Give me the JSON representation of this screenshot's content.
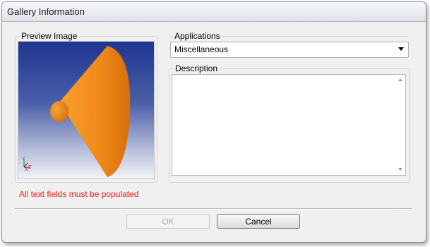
{
  "window": {
    "title": "Gallery Information"
  },
  "preview": {
    "label": "Preview Image",
    "axis_labels": [
      "Y",
      "X",
      "Z"
    ]
  },
  "applications": {
    "label": "Applications",
    "selected": "Miscellaneous"
  },
  "description": {
    "label": "Description",
    "value": ""
  },
  "validation": {
    "message": "All text fields must be populated"
  },
  "buttons": {
    "ok": "OK",
    "cancel": "Cancel"
  },
  "colors": {
    "error": "#e8221c",
    "cone": "#f28a1a",
    "preview_bg_top": "#1f3590"
  }
}
